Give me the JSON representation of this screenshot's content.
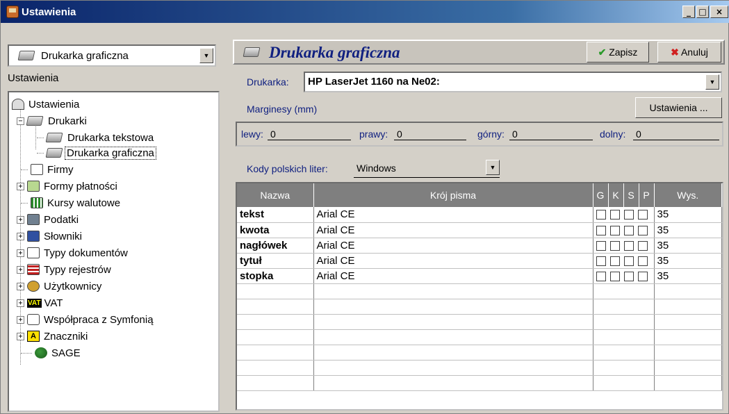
{
  "window": {
    "title": "Ustawienia",
    "min": "_",
    "max": "□",
    "close": "×"
  },
  "left": {
    "combo_label": "Drukarka graficzna",
    "section": "Ustawienia",
    "tree": [
      {
        "label": "Ustawienia"
      },
      {
        "label": "Drukarki"
      },
      {
        "label": "Drukarka tekstowa"
      },
      {
        "label": "Drukarka graficzna"
      },
      {
        "label": "Firmy"
      },
      {
        "label": "Formy płatności"
      },
      {
        "label": "Kursy walutowe"
      },
      {
        "label": "Podatki"
      },
      {
        "label": "Słowniki"
      },
      {
        "label": "Typy dokumentów"
      },
      {
        "label": "Typy rejestrów"
      },
      {
        "label": "Użytkownicy"
      },
      {
        "label": "VAT"
      },
      {
        "label": "Współpraca z Symfonią"
      },
      {
        "label": "Znaczniki"
      },
      {
        "label": "SAGE"
      }
    ],
    "vat_icon_text": "VAT",
    "znaczniki_icon_text": "A"
  },
  "right": {
    "title": "Drukarka graficzna",
    "save": "Zapisz",
    "cancel": "Anuluj",
    "printer_label": "Drukarka:",
    "printer_value": "HP LaserJet 1160 na Ne02:",
    "margins_label": "Marginesy (mm)",
    "settings_button": "Ustawienia ...",
    "margins": {
      "left_label": "lewy:",
      "left_value": "0",
      "right_label": "prawy:",
      "right_value": "0",
      "top_label": "górny:",
      "top_value": "0",
      "bottom_label": "dolny:",
      "bottom_value": "0"
    },
    "codes_label": "Kody polskich liter:",
    "codes_value": "Windows",
    "grid": {
      "headers": [
        "Nazwa",
        "Krój pisma",
        "G",
        "K",
        "S",
        "P",
        "Wys."
      ],
      "rows": [
        {
          "name": "tekst",
          "font": "Arial CE",
          "height": "35"
        },
        {
          "name": "kwota",
          "font": "Arial CE",
          "height": "35"
        },
        {
          "name": "nagłówek",
          "font": "Arial CE",
          "height": "35"
        },
        {
          "name": "tytuł",
          "font": "Arial CE",
          "height": "35"
        },
        {
          "name": "stopka",
          "font": "Arial CE",
          "height": "35"
        }
      ]
    }
  },
  "colors": {
    "titlebar": "#0a246a",
    "accent_text": "#102080",
    "header_bg": "#7f7f7f"
  }
}
